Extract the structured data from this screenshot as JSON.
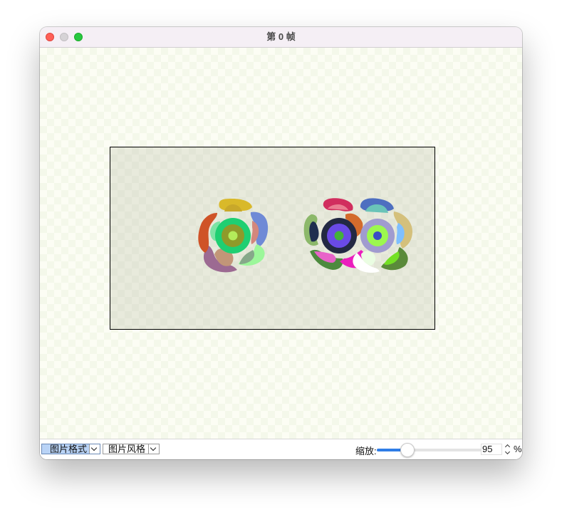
{
  "window": {
    "title": "第 0 帧"
  },
  "toolbar": {
    "format_combo": "图片格式",
    "style_combo": "图片风格",
    "zoom_label": "缩放:",
    "zoom_value": "95",
    "zoom_unit": "%",
    "zoom_fraction": 0.25
  },
  "colors": {
    "titlebar": "#f5eff5",
    "close": "#fe5f57",
    "minimize": "#d6d3d6",
    "maximize": "#28c840",
    "slider_fill": "#2f7de6",
    "selected_combo": "#b9d3f6"
  },
  "icons": [
    "chevron-down-icon",
    "stepper-up-icon",
    "stepper-down-icon"
  ]
}
